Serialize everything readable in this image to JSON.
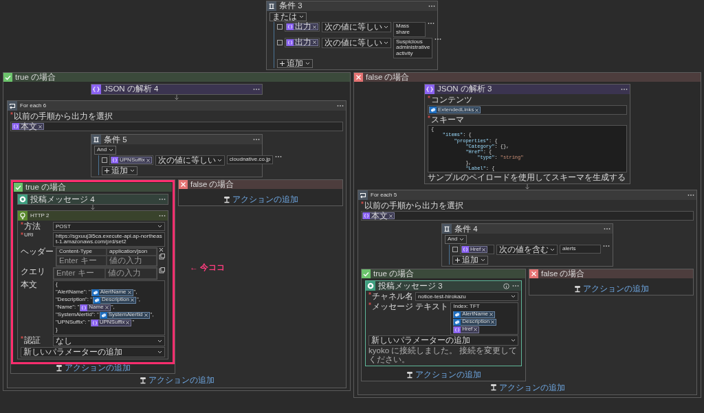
{
  "flow": {
    "kind": "condition",
    "title": "条件 3",
    "operator": "または",
    "add_label": "追加",
    "rows": [
      {
        "checked": false,
        "chip": {
          "kind": "variable",
          "label": "出力"
        },
        "operator": "次の値に等しい",
        "value": "Mass share"
      },
      {
        "checked": false,
        "chip": {
          "kind": "variable",
          "label": "出力"
        },
        "operator": "次の値に等しい",
        "value": "Suspicious administrative activity"
      }
    ],
    "branches": [
      {
        "kind": "yes",
        "title": "true の場合",
        "highlighted": false,
        "children": [
          {
            "kind": "json",
            "title": "JSON の解析 4",
            "selected": false
          },
          {
            "kind": "loop",
            "title": "For each 6",
            "input_label": "以前の手順から出力を選択",
            "required": true,
            "chips": [
              {
                "kind": "variable",
                "label": "本文"
              }
            ],
            "add_action": "アクションの追加",
            "children": [
              {
                "kind": "condition",
                "title": "条件 5",
                "operator": "And",
                "add_label": "追加",
                "rows": [
                  {
                    "checked": false,
                    "chip": {
                      "kind": "variable",
                      "label": "UPNSuffix"
                    },
                    "operator": "次の値に等しい",
                    "value": "cloudnative.co.jp"
                  }
                ],
                "branches": [
                  {
                    "kind": "yes",
                    "title": "true の場合",
                    "highlighted": true,
                    "annotation": "← 今ココ",
                    "add_action": "アクションの追加",
                    "children": [
                      {
                        "kind": "chat",
                        "title": "投稿メッセージ 4",
                        "selected": false
                      },
                      {
                        "kind": "http",
                        "title": "HTTP 2",
                        "selected": false,
                        "fields": [
                          {
                            "kind": "select",
                            "label": "方法",
                            "required": true,
                            "value": "POST"
                          },
                          {
                            "kind": "text",
                            "label": "URI",
                            "required": true,
                            "value": "https://sgxuuj3l5ca.execute-api.ap-northeast-1.amazonaws.com/prd/set2"
                          },
                          {
                            "kind": "keyvalue",
                            "label": "ヘッダー",
                            "required": false,
                            "rows": [
                              {
                                "key": {
                                  "value": "Content-Type"
                                },
                                "value": {
                                  "value": "application/json"
                                }
                              },
                              {
                                "key": {
                                  "placeholder": "Enter キー"
                                },
                                "value": {
                                  "placeholder": "値の入力"
                                }
                              }
                            ]
                          },
                          {
                            "kind": "keyvalue",
                            "label": "クエリ",
                            "required": false,
                            "rows": [
                              {
                                "key": {
                                  "placeholder": "Enter キー"
                                },
                                "value": {
                                  "placeholder": "値の入力"
                                }
                              }
                            ]
                          },
                          {
                            "kind": "tokens",
                            "label": "本文",
                            "required": false,
                            "lines": [
                              [
                                {
                                  "text": "{"
                                }
                              ],
                              [
                                {
                                  "text": "\"AlertName\": \""
                                },
                                {
                                  "chip": {
                                    "kind": "connector",
                                    "label": "AlertName"
                                  }
                                },
                                {
                                  "text": "\","
                                }
                              ],
                              [
                                {
                                  "text": "\"Description\": \""
                                },
                                {
                                  "chip": {
                                    "kind": "connector",
                                    "label": "Description"
                                  }
                                },
                                {
                                  "text": "\","
                                }
                              ],
                              [
                                {
                                  "text": "\"Name\": \""
                                },
                                {
                                  "chip": {
                                    "kind": "variable",
                                    "label": "Name"
                                  }
                                },
                                {
                                  "text": "\","
                                }
                              ],
                              [
                                {
                                  "text": "\"SystemAlertId\": \""
                                },
                                {
                                  "chip": {
                                    "kind": "connector",
                                    "label": "SystemAlertId"
                                  }
                                },
                                {
                                  "text": "\","
                                }
                              ],
                              [
                                {
                                  "text": "\"UPNSuffix\": \""
                                },
                                {
                                  "chip": {
                                    "kind": "variable",
                                    "label": "UPNSuffix"
                                  }
                                },
                                {
                                  "text": "\""
                                }
                              ],
                              [
                                {
                                  "text": "}"
                                }
                              ]
                            ]
                          },
                          {
                            "kind": "select",
                            "label": "認証",
                            "required": true,
                            "value": "なし"
                          },
                          {
                            "kind": "param",
                            "value": "新しいパラメーターの追加"
                          }
                        ]
                      }
                    ]
                  },
                  {
                    "kind": "no",
                    "title": "false の場合",
                    "highlighted": false,
                    "add_action": "アクションの追加"
                  }
                ]
              }
            ]
          }
        ]
      },
      {
        "kind": "no",
        "title": "false の場合",
        "highlighted": false,
        "children": [
          {
            "kind": "json",
            "title": "JSON の解析 3",
            "selected": false,
            "fields": [
              {
                "kind": "chips",
                "label": "コンテンツ",
                "required": true,
                "chips": [
                  {
                    "kind": "connector",
                    "label": "ExtendedLinks"
                  }
                ]
              },
              {
                "kind": "code",
                "label": "スキーマ",
                "required": true,
                "lines": [
                  "{",
                  "    \"items\": {",
                  "        \"properties\": {",
                  "            \"Category\": {},",
                  "            \"Href\": {",
                  "                \"type\": \"string\"",
                  "            },",
                  "            \"Label\": {"
                ]
              }
            ],
            "footer": {
              "kind": "link",
              "text": "サンプルのペイロードを使用してスキーマを生成する"
            }
          },
          {
            "kind": "loop",
            "title": "For each 5",
            "input_label": "以前の手順から出力を選択",
            "required": true,
            "chips": [
              {
                "kind": "variable",
                "label": "本文"
              }
            ],
            "add_action": "アクションの追加",
            "children": [
              {
                "kind": "condition",
                "title": "条件 4",
                "operator": "And",
                "add_label": "追加",
                "rows": [
                  {
                    "checked": false,
                    "chip": {
                      "kind": "variable",
                      "label": "Href"
                    },
                    "operator": "次の値を含む",
                    "value": "alerts"
                  }
                ],
                "branches": [
                  {
                    "kind": "yes",
                    "title": "true の場合",
                    "highlighted": false,
                    "add_action": "アクションの追加",
                    "children": [
                      {
                        "kind": "chat",
                        "title": "投稿メッセージ 3",
                        "selected": true,
                        "info": true,
                        "fields": [
                          {
                            "kind": "select",
                            "label": "チャネル名",
                            "required": true,
                            "value": "notice-test-hirokazu"
                          },
                          {
                            "kind": "tokens",
                            "label": "メッセージ テキスト",
                            "required": true,
                            "lines": [
                              [
                                {
                                  "text": "Index: TFT"
                                }
                              ],
                              [
                                {
                                  "chip": {
                                    "kind": "connector",
                                    "label": "AlertName"
                                  }
                                }
                              ],
                              [
                                {
                                  "chip": {
                                    "kind": "connector",
                                    "label": "Description"
                                  }
                                }
                              ],
                              [
                                {
                                  "chip": {
                                    "kind": "variable",
                                    "label": "Href"
                                  }
                                }
                              ]
                            ]
                          },
                          {
                            "kind": "param",
                            "value": "新しいパラメーターの追加"
                          }
                        ],
                        "footer": {
                          "kind": "note",
                          "text": "kyoko に接続しました。 接続を変更してください。"
                        }
                      }
                    ]
                  },
                  {
                    "kind": "no",
                    "title": "false の場合",
                    "highlighted": false,
                    "add_action": "アクションの追加"
                  }
                ]
              }
            ]
          }
        ]
      }
    ]
  }
}
